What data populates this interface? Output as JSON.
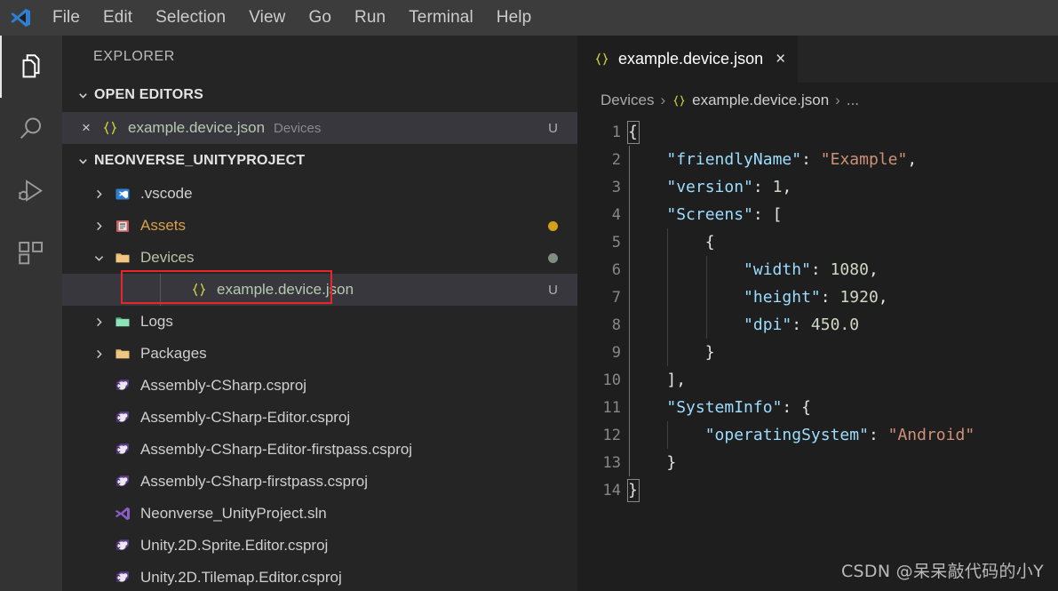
{
  "window": {
    "logo_icon": "vscode-logo-icon",
    "menu": [
      "File",
      "Edit",
      "Selection",
      "View",
      "Go",
      "Run",
      "Terminal",
      "Help"
    ]
  },
  "activitybar": {
    "items": [
      {
        "name": "explorer",
        "icon": "files-icon",
        "active": true
      },
      {
        "name": "search",
        "icon": "search-icon",
        "active": false
      },
      {
        "name": "run-and-debug",
        "icon": "run-debug-icon",
        "active": false
      },
      {
        "name": "extensions",
        "icon": "extensions-icon",
        "active": false
      }
    ]
  },
  "sidebar": {
    "title": "EXPLORER",
    "open_editors": {
      "header": "OPEN EDITORS",
      "expanded": true,
      "items": [
        {
          "close_glyph": "×",
          "icon": "json-braces-icon",
          "label": "example.device.json",
          "sublabel": "Devices",
          "badge": "U",
          "selected": true
        }
      ]
    },
    "project": {
      "header": "NEONVERSE_UNITYPROJECT",
      "expanded": true,
      "items": [
        {
          "label": ".vscode",
          "kind": "folder",
          "icon": "vscode-folder-icon",
          "expanded": false,
          "depth": 1,
          "badge": "",
          "dot": ""
        },
        {
          "label": "Assets",
          "kind": "folder",
          "icon": "assets-folder-icon",
          "expanded": false,
          "depth": 1,
          "badge": "",
          "dot": "#d4a017"
        },
        {
          "label": "Devices",
          "kind": "folder",
          "icon": "folder-icon",
          "expanded": true,
          "depth": 1,
          "badge": "",
          "dot": "#7e8f82"
        },
        {
          "label": "example.device.json",
          "kind": "json",
          "icon": "json-braces-icon",
          "depth": 2,
          "badge": "U",
          "dot": "",
          "selected": true,
          "annotated": true
        },
        {
          "label": "Logs",
          "kind": "folder",
          "icon": "logs-folder-icon",
          "expanded": false,
          "depth": 1,
          "badge": "",
          "dot": ""
        },
        {
          "label": "Packages",
          "kind": "folder",
          "icon": "folder-icon",
          "expanded": false,
          "depth": 1,
          "badge": "",
          "dot": ""
        },
        {
          "label": "Assembly-CSharp.csproj",
          "kind": "csproj",
          "icon": "csproj-icon",
          "depth": 1,
          "badge": "",
          "dot": ""
        },
        {
          "label": "Assembly-CSharp-Editor.csproj",
          "kind": "csproj",
          "icon": "csproj-icon",
          "depth": 1,
          "badge": "",
          "dot": ""
        },
        {
          "label": "Assembly-CSharp-Editor-firstpass.csproj",
          "kind": "csproj",
          "icon": "csproj-icon",
          "depth": 1,
          "badge": "",
          "dot": ""
        },
        {
          "label": "Assembly-CSharp-firstpass.csproj",
          "kind": "csproj",
          "icon": "csproj-icon",
          "depth": 1,
          "badge": "",
          "dot": ""
        },
        {
          "label": "Neonverse_UnityProject.sln",
          "kind": "sln",
          "icon": "sln-icon",
          "depth": 1,
          "badge": "",
          "dot": ""
        },
        {
          "label": "Unity.2D.Sprite.Editor.csproj",
          "kind": "csproj",
          "icon": "csproj-icon",
          "depth": 1,
          "badge": "",
          "dot": ""
        },
        {
          "label": "Unity.2D.Tilemap.Editor.csproj",
          "kind": "csproj",
          "icon": "csproj-icon",
          "depth": 1,
          "badge": "",
          "dot": ""
        }
      ]
    }
  },
  "editor": {
    "tab": {
      "icon": "json-braces-icon",
      "label": "example.device.json",
      "close_glyph": "×",
      "active": true
    },
    "breadcrumbs": {
      "folder": "Devices",
      "sep": "›",
      "file": "example.device.json",
      "file_icon": "json-braces-icon",
      "tail": "..."
    },
    "code": {
      "language": "json",
      "lines": [
        {
          "n": "1",
          "tokens": [
            {
              "t": "{",
              "c": "brace"
            }
          ]
        },
        {
          "n": "2",
          "tokens": [
            {
              "t": "    ",
              "c": "punc"
            },
            {
              "t": "\"friendlyName\"",
              "c": "key"
            },
            {
              "t": ": ",
              "c": "punc"
            },
            {
              "t": "\"Example\"",
              "c": "str"
            },
            {
              "t": ",",
              "c": "punc"
            }
          ]
        },
        {
          "n": "3",
          "tokens": [
            {
              "t": "    ",
              "c": "punc"
            },
            {
              "t": "\"version\"",
              "c": "key"
            },
            {
              "t": ": ",
              "c": "punc"
            },
            {
              "t": "1",
              "c": "num"
            },
            {
              "t": ",",
              "c": "punc"
            }
          ]
        },
        {
          "n": "4",
          "tokens": [
            {
              "t": "    ",
              "c": "punc"
            },
            {
              "t": "\"Screens\"",
              "c": "key"
            },
            {
              "t": ": ",
              "c": "punc"
            },
            {
              "t": "[",
              "c": "brace"
            }
          ]
        },
        {
          "n": "5",
          "tokens": [
            {
              "t": "        ",
              "c": "punc"
            },
            {
              "t": "{",
              "c": "brace"
            }
          ]
        },
        {
          "n": "6",
          "tokens": [
            {
              "t": "            ",
              "c": "punc"
            },
            {
              "t": "\"width\"",
              "c": "key"
            },
            {
              "t": ": ",
              "c": "punc"
            },
            {
              "t": "1080",
              "c": "num"
            },
            {
              "t": ",",
              "c": "punc"
            }
          ]
        },
        {
          "n": "7",
          "tokens": [
            {
              "t": "            ",
              "c": "punc"
            },
            {
              "t": "\"height\"",
              "c": "key"
            },
            {
              "t": ": ",
              "c": "punc"
            },
            {
              "t": "1920",
              "c": "num"
            },
            {
              "t": ",",
              "c": "punc"
            }
          ]
        },
        {
          "n": "8",
          "tokens": [
            {
              "t": "            ",
              "c": "punc"
            },
            {
              "t": "\"dpi\"",
              "c": "key"
            },
            {
              "t": ": ",
              "c": "punc"
            },
            {
              "t": "450.0",
              "c": "num"
            }
          ]
        },
        {
          "n": "9",
          "tokens": [
            {
              "t": "        ",
              "c": "punc"
            },
            {
              "t": "}",
              "c": "brace"
            }
          ]
        },
        {
          "n": "10",
          "tokens": [
            {
              "t": "    ",
              "c": "punc"
            },
            {
              "t": "]",
              "c": "brace"
            },
            {
              "t": ",",
              "c": "punc"
            }
          ]
        },
        {
          "n": "11",
          "tokens": [
            {
              "t": "    ",
              "c": "punc"
            },
            {
              "t": "\"SystemInfo\"",
              "c": "key"
            },
            {
              "t": ": ",
              "c": "punc"
            },
            {
              "t": "{",
              "c": "brace"
            }
          ]
        },
        {
          "n": "12",
          "tokens": [
            {
              "t": "        ",
              "c": "punc"
            },
            {
              "t": "\"operatingSystem\"",
              "c": "key"
            },
            {
              "t": ": ",
              "c": "punc"
            },
            {
              "t": "\"Android\"",
              "c": "str"
            }
          ]
        },
        {
          "n": "13",
          "tokens": [
            {
              "t": "    ",
              "c": "punc"
            },
            {
              "t": "}",
              "c": "brace"
            }
          ]
        },
        {
          "n": "14",
          "tokens": [
            {
              "t": "}",
              "c": "brace"
            }
          ]
        }
      ]
    }
  },
  "watermark": "CSDN @呆呆敲代码的小Y",
  "colors": {
    "titlebar_bg": "#3c3c3c",
    "activitybar_bg": "#333333",
    "sidebar_bg": "#252526",
    "editor_bg": "#1e1e1e",
    "selection_bg": "#37373d",
    "annotation_red": "#e8252a",
    "json_key": "#9cdcfe",
    "json_string": "#ce9178",
    "json_number": "#cfd8c4",
    "assets_dot": "#d4a017",
    "devices_dot": "#7e8f82"
  }
}
